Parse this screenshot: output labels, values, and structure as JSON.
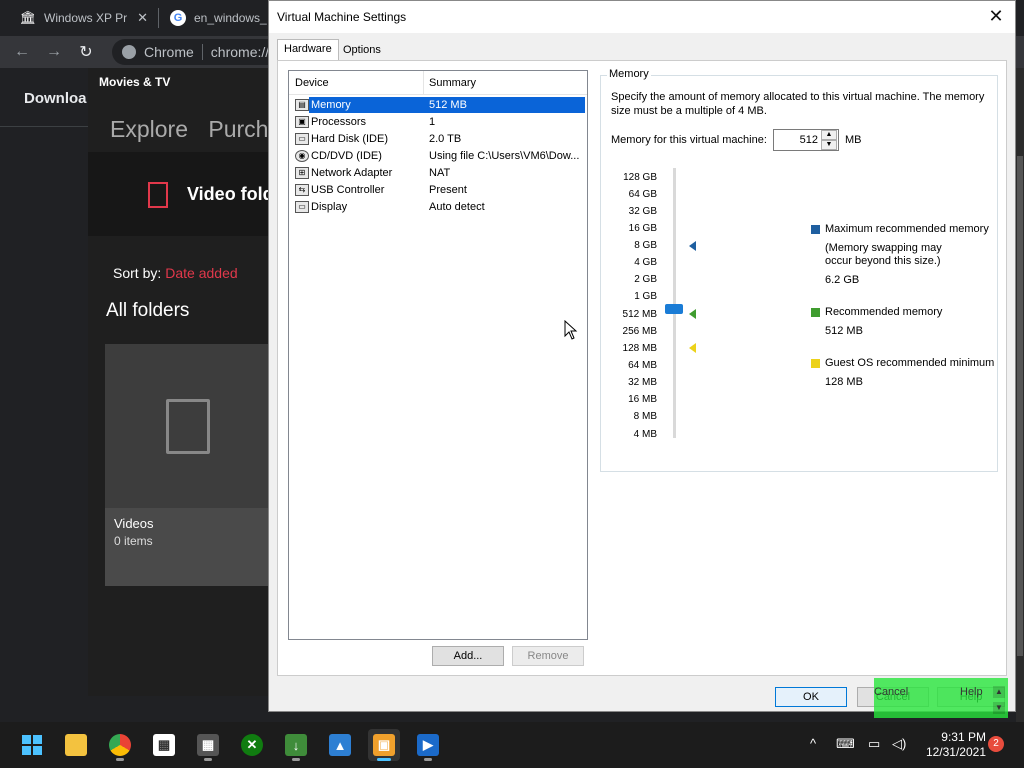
{
  "chrome": {
    "tabs": [
      {
        "title": "Windows XP Pr",
        "icon": "museum-icon"
      },
      {
        "title": "en_windows_",
        "icon": "google-icon"
      }
    ],
    "omnibox": {
      "scheme": "Chrome",
      "url": "chrome://"
    },
    "page_heading": "Downloa"
  },
  "movies": {
    "app_title": "Movies & TV",
    "nav": [
      "Explore",
      "Purcha"
    ],
    "header": "Video fold",
    "sort_label": "Sort by:",
    "sort_value": "Date added",
    "section": "All folders",
    "tile": {
      "name": "Videos",
      "count": "0 items"
    },
    "accent": "#e1384b"
  },
  "dialog": {
    "title": "Virtual Machine Settings",
    "close_icon": "close-icon",
    "tabs": [
      "Hardware",
      "Options"
    ],
    "devices": {
      "columns": [
        "Device",
        "Summary"
      ],
      "rows": [
        {
          "name": "Memory",
          "summary": "512 MB",
          "icon": "memory-icon",
          "selected": true
        },
        {
          "name": "Processors",
          "summary": "1",
          "icon": "cpu-icon"
        },
        {
          "name": "Hard Disk (IDE)",
          "summary": "2.0 TB",
          "icon": "hard-disk-icon"
        },
        {
          "name": "CD/DVD (IDE)",
          "summary": "Using file C:\\Users\\VM6\\Dow...",
          "icon": "cd-dvd-icon"
        },
        {
          "name": "Network Adapter",
          "summary": "NAT",
          "icon": "network-icon"
        },
        {
          "name": "USB Controller",
          "summary": "Present",
          "icon": "usb-icon"
        },
        {
          "name": "Display",
          "summary": "Auto detect",
          "icon": "display-icon"
        }
      ]
    },
    "add_button": "Add...",
    "remove_button": "Remove",
    "memory": {
      "legend": "Memory",
      "description": "Specify the amount of memory allocated to this virtual machine. The memory size must be a multiple of 4 MB.",
      "field_label": "Memory for this virtual machine:",
      "value": "512",
      "unit": "MB",
      "scale": [
        "128 GB",
        "64 GB",
        "32 GB",
        "16 GB",
        "8 GB",
        "4 GB",
        "2 GB",
        "1 GB",
        "512 MB",
        "256 MB",
        "128 MB",
        "64 MB",
        "32 MB",
        "16 MB",
        "8 MB",
        "4 MB"
      ],
      "legend_items": {
        "max": {
          "title": "Maximum recommended memory",
          "note1": "(Memory swapping may",
          "note2": "occur beyond this size.)",
          "value": "6.2 GB",
          "color": "#1f5fa0"
        },
        "rec": {
          "title": "Recommended memory",
          "value": "512 MB",
          "color": "#3f9c2f"
        },
        "min": {
          "title": "Guest OS recommended minimum",
          "value": "128 MB",
          "color": "#ecd21a"
        }
      }
    },
    "ok_button": "OK",
    "cancel_button": "Cancel",
    "help_button": "Help"
  },
  "taskbar": {
    "apps": [
      "start-icon",
      "file-explorer-icon",
      "chrome-icon",
      "store-icon",
      "calculator-icon",
      "xbox-icon",
      "downloads-icon",
      "photos-icon",
      "vmware-icon",
      "movies-tv-icon"
    ],
    "time": "9:31 PM",
    "date": "12/31/2021",
    "notification_count": "2"
  }
}
